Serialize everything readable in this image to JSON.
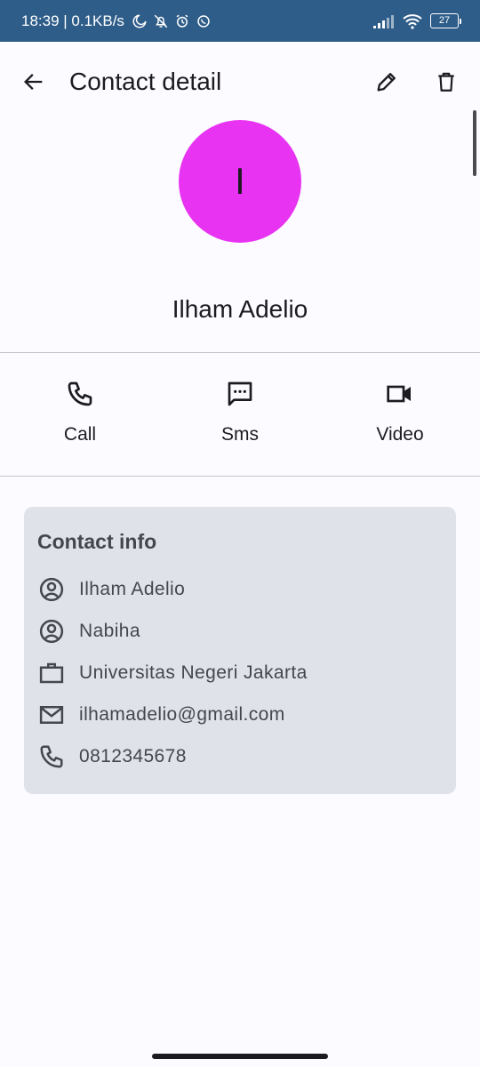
{
  "status_bar": {
    "time_speed": "18:39 | 0.1KB/s",
    "battery": "27",
    "icons": [
      "moon-icon",
      "bell-off-icon",
      "alarm-icon",
      "whatsapp-icon",
      "signal-icon",
      "wifi-icon",
      "battery-icon"
    ]
  },
  "app_bar": {
    "title": "Contact detail",
    "icons": [
      "arrow-back-icon",
      "pencil-icon",
      "trash-icon"
    ]
  },
  "profile": {
    "initial": "I",
    "name": "Ilham Adelio",
    "avatar_color": "#e833f2"
  },
  "actions": [
    {
      "label": "Call",
      "icon": "phone-icon"
    },
    {
      "label": "Sms",
      "icon": "sms-icon"
    },
    {
      "label": "Video",
      "icon": "video-icon"
    }
  ],
  "contact_info": {
    "title": "Contact info",
    "rows": [
      {
        "icon": "person-icon",
        "value": "Ilham Adelio"
      },
      {
        "icon": "person-icon",
        "value": "Nabiha"
      },
      {
        "icon": "briefcase-icon",
        "value": "Universitas Negeri Jakarta"
      },
      {
        "icon": "mail-icon",
        "value": "ilhamadelio@gmail.com"
      },
      {
        "icon": "phone-icon",
        "value": "0812345678"
      }
    ]
  },
  "colors": {
    "status_bar": "#2f5d89",
    "background": "#fcfbff",
    "card": "#e0e2ea",
    "text_primary": "#1c1b1f",
    "text_secondary": "#44474e"
  }
}
